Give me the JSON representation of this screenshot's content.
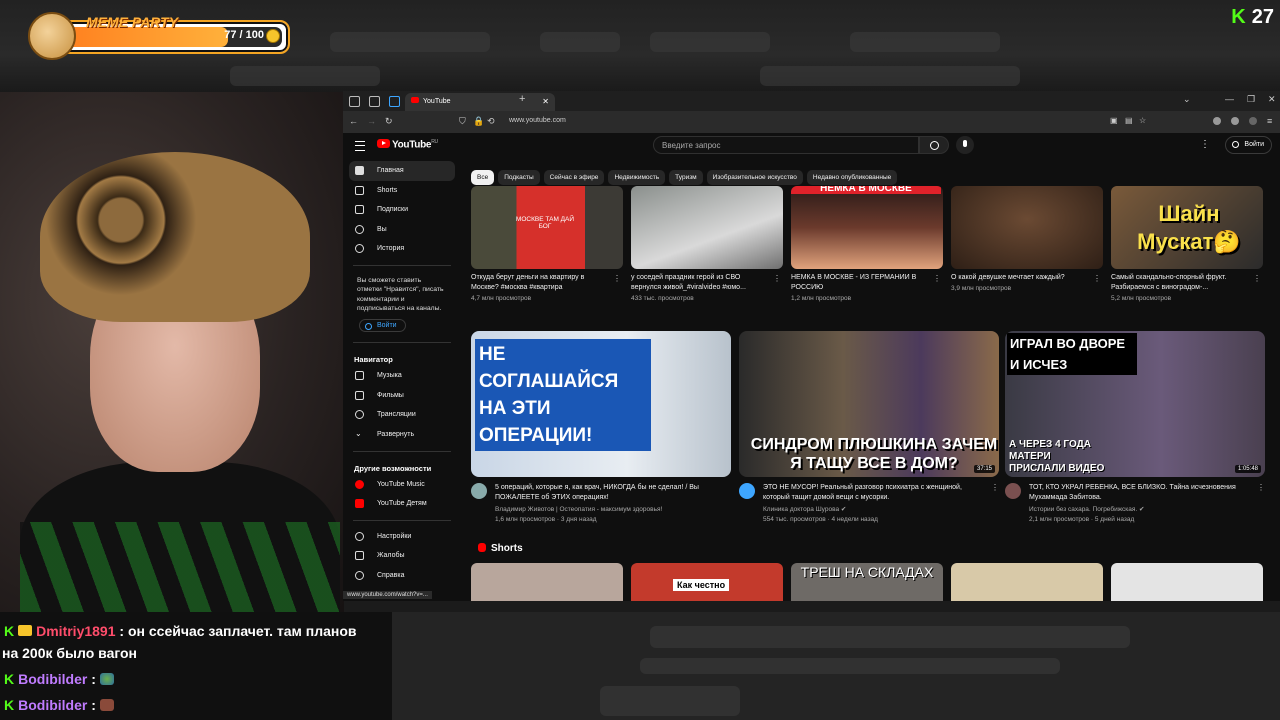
{
  "overlay": {
    "badge_title": "MEME PARTY",
    "badge_progress": 0.77,
    "badge_count": "77 / 100",
    "viewer_count": "27",
    "kick_logo": "K"
  },
  "browser": {
    "tab_title": "YouTube",
    "url": "www.youtube.com",
    "status_url": "www.youtube.com/watch?v=..."
  },
  "youtube": {
    "logo": "YouTube",
    "logo_region": "RU",
    "search_placeholder": "Введите запрос",
    "signin_label": "Войти",
    "sidebar": {
      "main": [
        "Главная",
        "Shorts",
        "Подписки",
        "Вы",
        "История"
      ],
      "note": "Вы сможете ставить отметки \"Нравится\", писать комментарии и подписываться на каналы.",
      "signin_label": "Войти",
      "navigator_title": "Навигатор",
      "navigator": [
        "Музыка",
        "Фильмы",
        "Трансляции",
        "Развернуть"
      ],
      "more_title": "Другие возможности",
      "more": [
        "YouTube Music",
        "YouTube Детям"
      ],
      "settings": [
        "Настройки",
        "Жалобы",
        "Справка"
      ]
    },
    "chips": [
      "Все",
      "Подкасты",
      "Сейчас в эфире",
      "Недвижимость",
      "Туризм",
      "Изобразительное искусство",
      "Недавно опубликованные"
    ],
    "row1": [
      {
        "title": "Откуда берут деньги на квартиру в Москве? #москва #квартира",
        "meta": "4,7 млн просмотров",
        "thumb_text": "МОСКВЕ ТАМ ДАЙ БОГ"
      },
      {
        "title": "у соседей праздник герой из СВО вернулся живой_#viralvideo #юмо...",
        "meta": "433 тыс. просмотров",
        "thumb_text": ""
      },
      {
        "title": "НЕМКА В МОСКВЕ - ИЗ ГЕРМАНИИ В РОССИЮ",
        "meta": "1,2 млн просмотров",
        "thumb_text": "НЕМКА В МОСКВЕ"
      },
      {
        "title": "О какой девушке мечтает каждый?",
        "meta": "3,9 млн просмотров",
        "thumb_text": ""
      },
      {
        "title": "Самый скандально-спорный фрукт. Разбираемся с виноградом-...",
        "meta": "5,2 млн просмотров",
        "thumb_text": "Шайн Мускат🤔"
      }
    ],
    "row2": [
      {
        "thumb_text": "НЕ СОГЛАШАЙСЯ НА ЭТИ ОПЕРАЦИИ!",
        "title": "5 операций, которые я, как врач, НИКОГДА бы не сделал! / Вы ПОЖАЛЕЕТЕ об ЭТИХ операциях!",
        "channel": "Владимир Животов | Остеопатия - максимум здоровья!",
        "meta": "1,6 млн просмотров · 3 дня назад",
        "duration": ""
      },
      {
        "thumb_text": "СИНДРОМ ПЛЮШКИНА ЗАЧЕМ Я ТАЩУ ВСЕ В ДОМ?",
        "title": "ЭТО НЕ МУСОР! Реальный разговор психиатра с женщиной, который тащит домой вещи с мусорки.",
        "channel": "Клиника доктора Шурова ✔",
        "meta": "554 тыс. просмотров · 4 недели назад",
        "duration": "37:15"
      },
      {
        "thumb_text": "ИГРАЛ ВО ДВОРЕ И ИСЧЕЗ",
        "thumb_text2": "А ЧЕРЕЗ 4 ГОДА МАТЕРИ ПРИСЛАЛИ ВИДЕО",
        "title": "ТОТ, КТО УКРАЛ РЕБЕНКА, ВСЕ БЛИЗКО. Тайна исчезновения Мухаммада Забитова.",
        "channel": "Истории без сахара. Погребижская. ✔",
        "meta": "2,1 млн просмотров · 5 дней назад",
        "duration": "1:05:48"
      }
    ],
    "shorts_title": "Shorts",
    "shorts": [
      "",
      "Как честно",
      "ТРЕШ НА СКЛАДАХ",
      "",
      ""
    ]
  },
  "chat": {
    "messages": [
      {
        "user": "Dmitriy1891",
        "text": "он ссейчас заплачет. там планов",
        "text2": "на 200к было вагон"
      },
      {
        "user": "Bodibilder",
        "text": ""
      },
      {
        "user": "Bodibilder",
        "text": ""
      }
    ]
  },
  "colors": {
    "youtube_red": "#ff0000",
    "kick_green": "#53fc18",
    "badge_orange": "#f4a523"
  }
}
